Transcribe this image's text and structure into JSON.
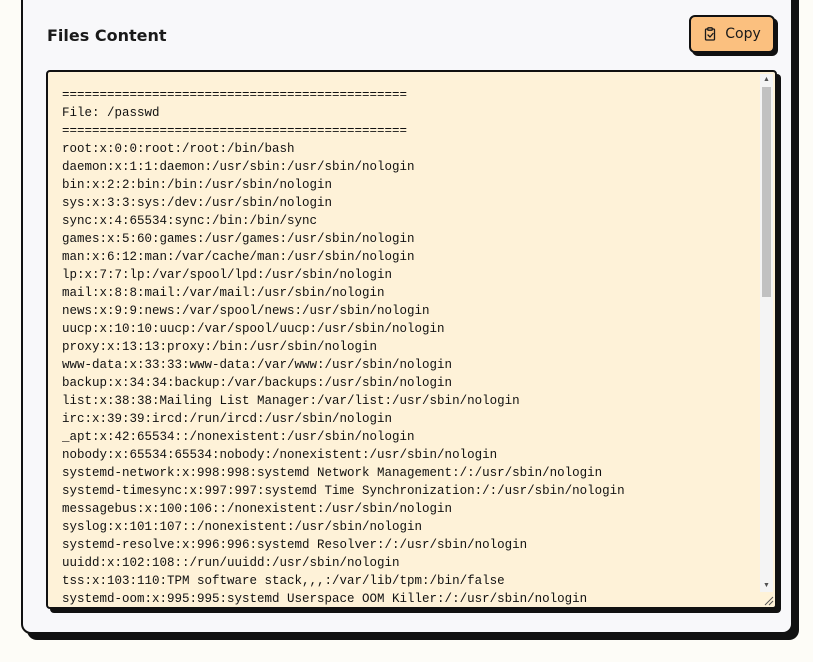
{
  "panel": {
    "title": "Files Content",
    "copy_label": "Copy",
    "copy_icon": "clipboard-icon"
  },
  "content": {
    "lines": [
      "==============================================",
      "File: /passwd",
      "==============================================",
      "root:x:0:0:root:/root:/bin/bash",
      "daemon:x:1:1:daemon:/usr/sbin:/usr/sbin/nologin",
      "bin:x:2:2:bin:/bin:/usr/sbin/nologin",
      "sys:x:3:3:sys:/dev:/usr/sbin/nologin",
      "sync:x:4:65534:sync:/bin:/bin/sync",
      "games:x:5:60:games:/usr/games:/usr/sbin/nologin",
      "man:x:6:12:man:/var/cache/man:/usr/sbin/nologin",
      "lp:x:7:7:lp:/var/spool/lpd:/usr/sbin/nologin",
      "mail:x:8:8:mail:/var/mail:/usr/sbin/nologin",
      "news:x:9:9:news:/var/spool/news:/usr/sbin/nologin",
      "uucp:x:10:10:uucp:/var/spool/uucp:/usr/sbin/nologin",
      "proxy:x:13:13:proxy:/bin:/usr/sbin/nologin",
      "www-data:x:33:33:www-data:/var/www:/usr/sbin/nologin",
      "backup:x:34:34:backup:/var/backups:/usr/sbin/nologin",
      "list:x:38:38:Mailing List Manager:/var/list:/usr/sbin/nologin",
      "irc:x:39:39:ircd:/run/ircd:/usr/sbin/nologin",
      "_apt:x:42:65534::/nonexistent:/usr/sbin/nologin",
      "nobody:x:65534:65534:nobody:/nonexistent:/usr/sbin/nologin",
      "systemd-network:x:998:998:systemd Network Management:/:/usr/sbin/nologin",
      "systemd-timesync:x:997:997:systemd Time Synchronization:/:/usr/sbin/nologin",
      "messagebus:x:100:106::/nonexistent:/usr/sbin/nologin",
      "syslog:x:101:107::/nonexistent:/usr/sbin/nologin",
      "systemd-resolve:x:996:996:systemd Resolver:/:/usr/sbin/nologin",
      "uuidd:x:102:108::/run/uuidd:/usr/sbin/nologin",
      "tss:x:103:110:TPM software stack,,,:/var/lib/tpm:/bin/false",
      "systemd-oom:x:995:995:systemd Userspace OOM Killer:/:/usr/sbin/nologin"
    ]
  },
  "scrollbar": {
    "up_icon": "arrow-up-icon",
    "down_icon": "arrow-down-icon",
    "position_fraction": 0.0
  },
  "colors": {
    "button_bg": "#fbc07f",
    "content_bg": "#fef2d8",
    "panel_bg": "#f8f8fa",
    "border": "#111111"
  }
}
